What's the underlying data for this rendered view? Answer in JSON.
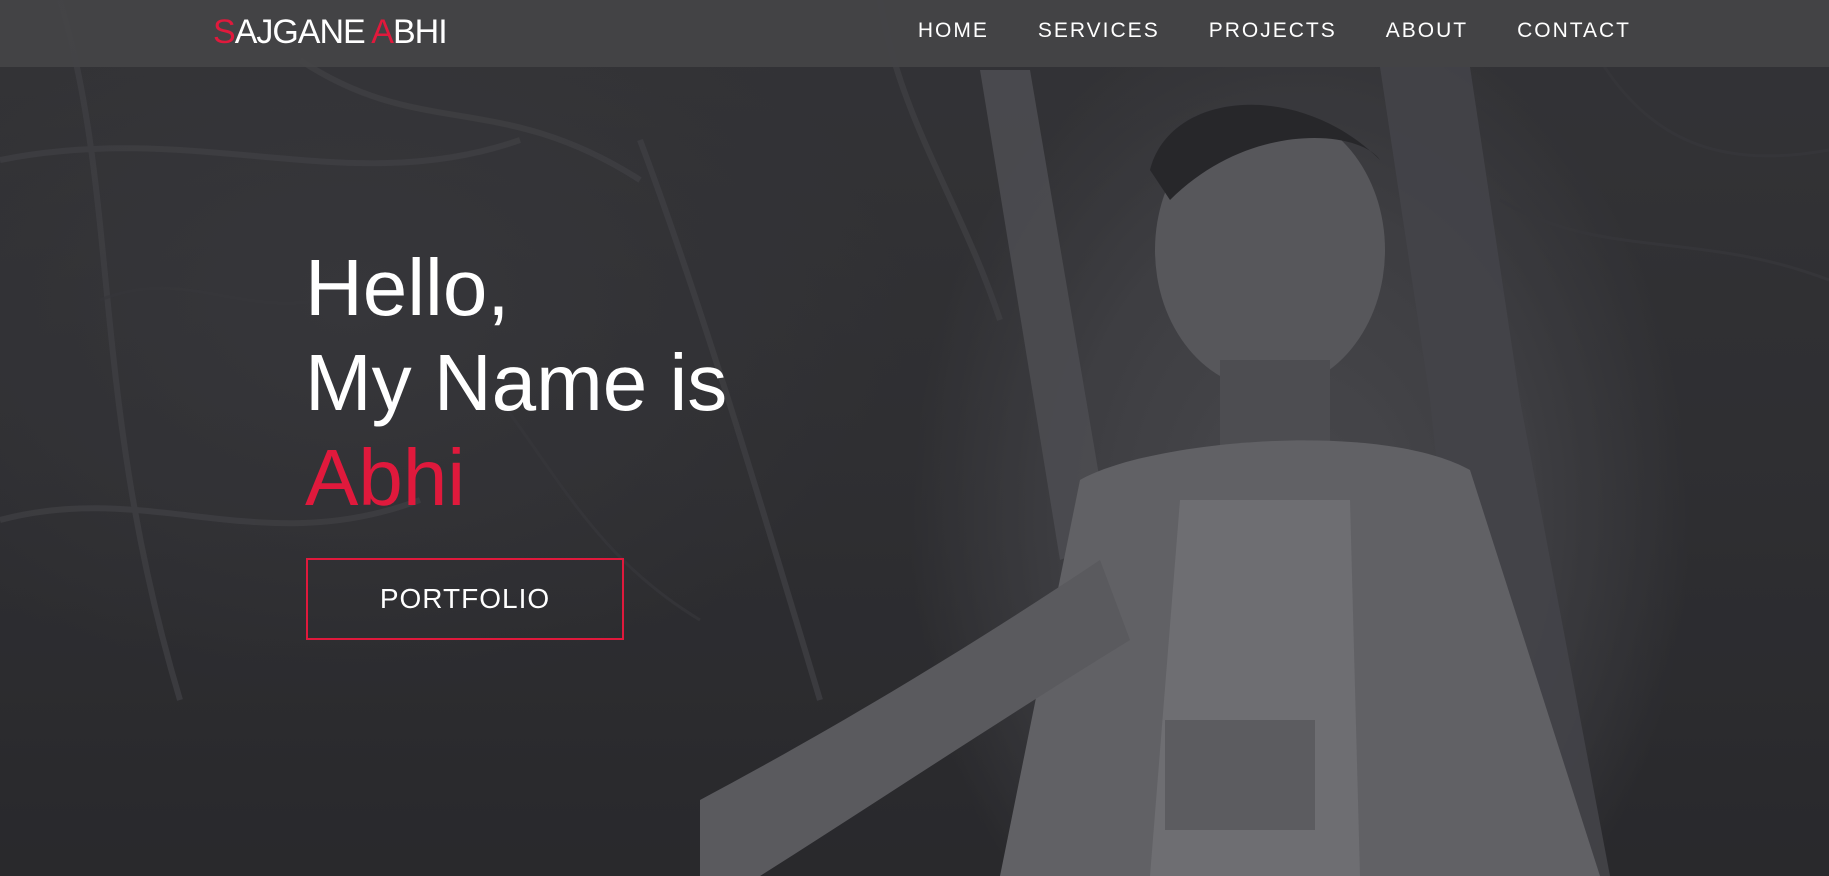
{
  "logo": {
    "part1_accent": "S",
    "part1_rest": "AJGANE ",
    "part2_accent": "A",
    "part2_rest": "BHI"
  },
  "nav": {
    "items": [
      {
        "label": "HOME"
      },
      {
        "label": "SERVICES"
      },
      {
        "label": "PROJECTS"
      },
      {
        "label": "ABOUT"
      },
      {
        "label": "CONTACT"
      }
    ]
  },
  "hero": {
    "line1": "Hello,",
    "line2": "My Name is",
    "name": "Abhi",
    "cta_label": "PORTFOLIO"
  },
  "colors": {
    "accent": "#e0193c",
    "navbar": "#444446",
    "text": "#ffffff"
  }
}
